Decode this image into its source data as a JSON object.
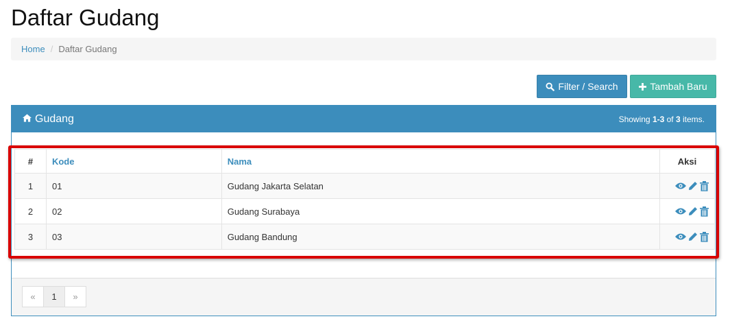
{
  "page": {
    "title": "Daftar Gudang"
  },
  "breadcrumb": {
    "home": "Home",
    "separator": "/",
    "current": "Daftar Gudang"
  },
  "toolbar": {
    "filter_label": "Filter / Search",
    "add_label": "Tambah Baru"
  },
  "panel": {
    "title": "Gudang",
    "summary_prefix": "Showing ",
    "summary_range": "1-3",
    "summary_mid": " of ",
    "summary_total": "3",
    "summary_suffix": " items."
  },
  "table": {
    "headers": {
      "num": "#",
      "kode": "Kode",
      "nama": "Nama",
      "aksi": "Aksi"
    },
    "rows": [
      {
        "num": "1",
        "kode": "01",
        "nama": "Gudang Jakarta Selatan"
      },
      {
        "num": "2",
        "kode": "02",
        "nama": "Gudang Surabaya"
      },
      {
        "num": "3",
        "kode": "03",
        "nama": "Gudang Bandung"
      }
    ]
  },
  "pagination": {
    "prev": "«",
    "current": "1",
    "next": "»"
  },
  "icons": {
    "filter": "search-icon",
    "add": "plus-icon",
    "panel": "home-icon",
    "view": "eye-icon",
    "edit": "pencil-icon",
    "delete": "trash-icon"
  },
  "colors": {
    "primary": "#3c8dbc",
    "success": "#47b8a8",
    "highlight": "#d90000"
  }
}
